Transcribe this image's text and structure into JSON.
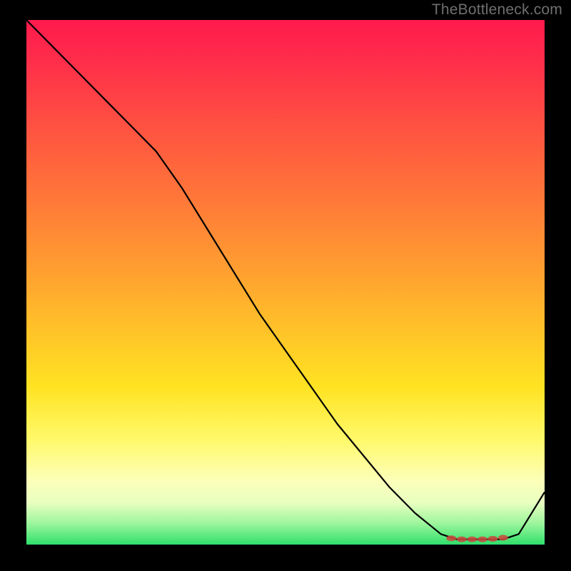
{
  "attribution": "TheBottleneck.com",
  "chart_data": {
    "type": "line",
    "title": "",
    "xlabel": "",
    "ylabel": "",
    "xlim": [
      0,
      100
    ],
    "ylim": [
      0,
      100
    ],
    "grid": false,
    "legend": false,
    "background_gradient": [
      "#ff1a4d",
      "#ff7a38",
      "#ffe322",
      "#fcffba",
      "#2fe06a"
    ],
    "series": [
      {
        "name": "bottleneck-curve",
        "color": "#000000",
        "x": [
          0,
          5,
          10,
          15,
          20,
          25,
          30,
          35,
          40,
          45,
          50,
          55,
          60,
          65,
          70,
          75,
          80,
          83,
          86,
          89,
          92,
          95,
          100
        ],
        "values": [
          100,
          95,
          90,
          85,
          80,
          75,
          68,
          60,
          52,
          44,
          37,
          30,
          23,
          17,
          11,
          6,
          2,
          1,
          1,
          1,
          1,
          2,
          10
        ]
      }
    ],
    "markers": {
      "name": "flat-valley-markers",
      "color": "#c94a3f",
      "x": [
        82,
        84,
        86,
        88,
        90,
        92
      ],
      "values": [
        1.2,
        1.0,
        1.0,
        1.0,
        1.1,
        1.3
      ]
    }
  }
}
